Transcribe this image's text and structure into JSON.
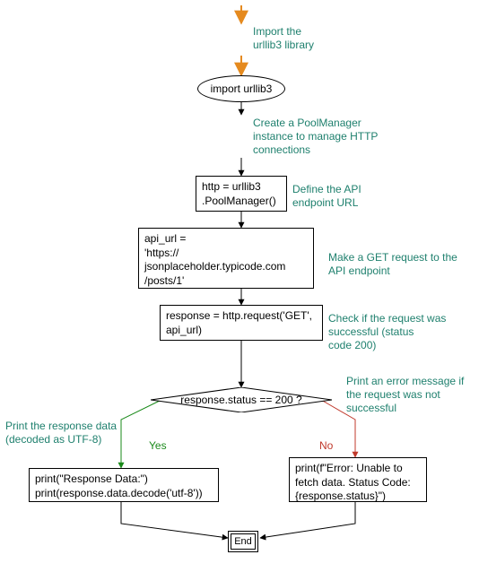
{
  "chart_data": {
    "type": "flowchart",
    "nodes": [
      {
        "id": "start_arrow",
        "shape": "entry-arrow"
      },
      {
        "id": "import",
        "shape": "ellipse",
        "label": "import urllib3"
      },
      {
        "id": "pool",
        "shape": "rect",
        "label": "http = urllib3\n.PoolManager()"
      },
      {
        "id": "api_url",
        "shape": "rect",
        "label": "api_url =\n'https://\njsonplaceholder.typicode.com\n/posts/1'"
      },
      {
        "id": "request",
        "shape": "rect",
        "label": "response = http.request('GET',\napi_url)"
      },
      {
        "id": "decision",
        "shape": "diamond",
        "label": "response.status == 200 ?"
      },
      {
        "id": "print_ok",
        "shape": "rect",
        "label": "print(\"Response Data:\")\nprint(response.data.decode('utf-8'))"
      },
      {
        "id": "print_err",
        "shape": "rect",
        "label": "print(f\"Error: Unable to\nfetch data. Status Code:\n{response.status}\")"
      },
      {
        "id": "end",
        "shape": "terminator",
        "label": "End"
      }
    ],
    "edges": [
      {
        "from": "start_arrow",
        "to": "import"
      },
      {
        "from": "import",
        "to": "pool"
      },
      {
        "from": "pool",
        "to": "api_url"
      },
      {
        "from": "api_url",
        "to": "request"
      },
      {
        "from": "request",
        "to": "decision"
      },
      {
        "from": "decision",
        "to": "print_ok",
        "label": "Yes",
        "color": "green"
      },
      {
        "from": "decision",
        "to": "print_err",
        "label": "No",
        "color": "red"
      },
      {
        "from": "print_ok",
        "to": "end"
      },
      {
        "from": "print_err",
        "to": "end"
      }
    ],
    "annotations": [
      {
        "attached_to": "start_arrow",
        "text": "Import the\nurllib3 library"
      },
      {
        "attached_to": "pool",
        "text": "Create a PoolManager\ninstance to manage HTTP\nconnections"
      },
      {
        "attached_to": "api_url",
        "side": "right",
        "text": "Define the API\nendpoint URL"
      },
      {
        "attached_to": "request",
        "side": "right",
        "text": "Make a GET request to the\nAPI endpoint"
      },
      {
        "attached_to": "decision",
        "side": "right",
        "text": "Check if the request was\nsuccessful (status\ncode 200)"
      },
      {
        "attached_to": "print_ok",
        "side": "left",
        "text": "Print the response data\n(decoded as UTF-8)"
      },
      {
        "attached_to": "print_err",
        "side": "right",
        "text": "Print an error message if\nthe request was not\nsuccessful"
      }
    ]
  },
  "nodes": {
    "import": "import urllib3",
    "pool_l1": "http = urllib3",
    "pool_l2": ".PoolManager()",
    "api_l1": "api_url =",
    "api_l2": "'https://",
    "api_l3": "jsonplaceholder.typicode.com",
    "api_l4": "/posts/1'",
    "request_l1": "response = http.request('GET',",
    "request_l2": "api_url)",
    "decision": "response.status == 200 ?",
    "ok_l1": "print(\"Response Data:\")",
    "ok_l2": "print(response.data.decode('utf-8'))",
    "err_l1": "print(f\"Error: Unable to",
    "err_l2": "fetch data. Status Code:",
    "err_l3": "{response.status}\")",
    "end": "End"
  },
  "annots": {
    "a_start_l1": "Import the",
    "a_start_l2": "urllib3 library",
    "a_pool_l1": "Create a PoolManager",
    "a_pool_l2": "instance to manage HTTP",
    "a_pool_l3": "connections",
    "a_api_l1": "Define the API",
    "a_api_l2": "endpoint URL",
    "a_req_l1": "Make a GET request to the",
    "a_req_l2": "API endpoint",
    "a_dec_l1": "Check if the request was",
    "a_dec_l2": "successful (status",
    "a_dec_l3": "code 200)",
    "a_ok_l1": "Print the response data",
    "a_ok_l2": "(decoded as UTF-8)",
    "a_err_l1": "Print an error message if",
    "a_err_l2": "the request was not",
    "a_err_l3": "successful"
  },
  "edges": {
    "yes": "Yes",
    "no": "No"
  },
  "colors": {
    "accent": "#1f806e",
    "yes_arrow": "#1a8a1a",
    "no_arrow": "#c0392b",
    "start_arrow": "#e58a1f"
  }
}
